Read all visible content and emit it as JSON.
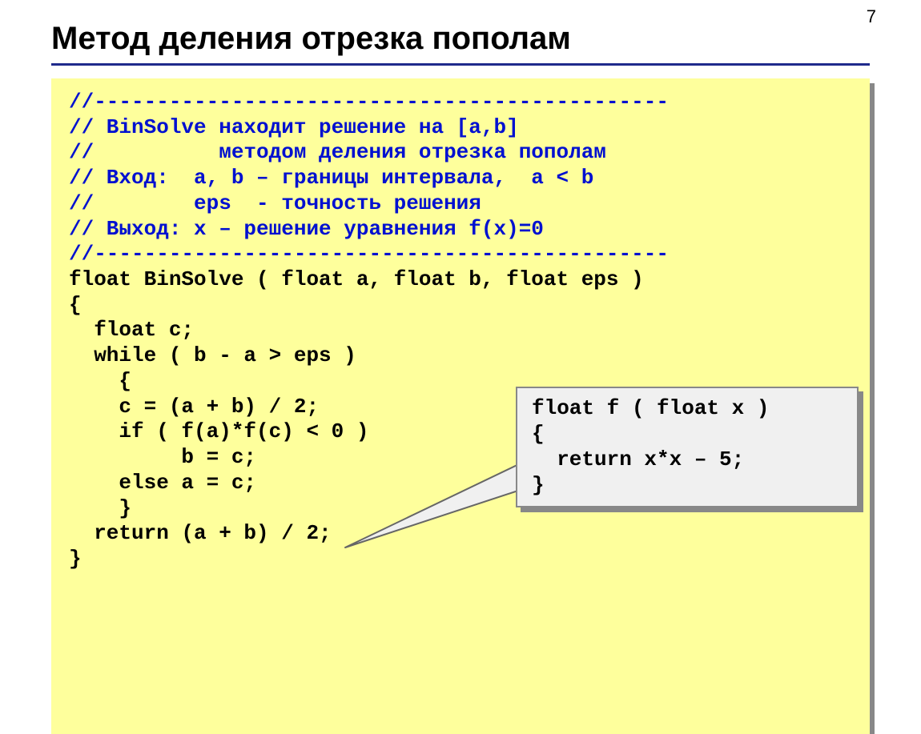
{
  "pageNumber": "7",
  "title": "Метод деления отрезка пополам",
  "code": {
    "c1": "//----------------------------------------------",
    "c2": "// BinSolve находит решение на [a,b]",
    "c3": "//          методом деления отрезка пополам",
    "c4": "// Вход:  a, b – границы интервала,  a < b",
    "c5": "//        eps  - точность решения",
    "c6": "// Выход: x – решение уравнения f(x)=0",
    "c7": "//----------------------------------------------",
    "l1": "float BinSolve ( float a, float b, float eps )",
    "l2": "{",
    "l3": "  float c;",
    "l4": "  while ( b - a > eps )",
    "l5": "    {",
    "l6": "    c = (a + b) / 2;",
    "l7": "    if ( f(a)*f(c) < 0 )",
    "l8": "         b = c;",
    "l9": "    else a = c;",
    "l10": "    }",
    "l11": "  return (a + b) / 2;",
    "l12": "}"
  },
  "inset": {
    "l1": "float f ( float x )",
    "l2": "{",
    "l3": "  return x*x – 5;",
    "l4": "}"
  }
}
